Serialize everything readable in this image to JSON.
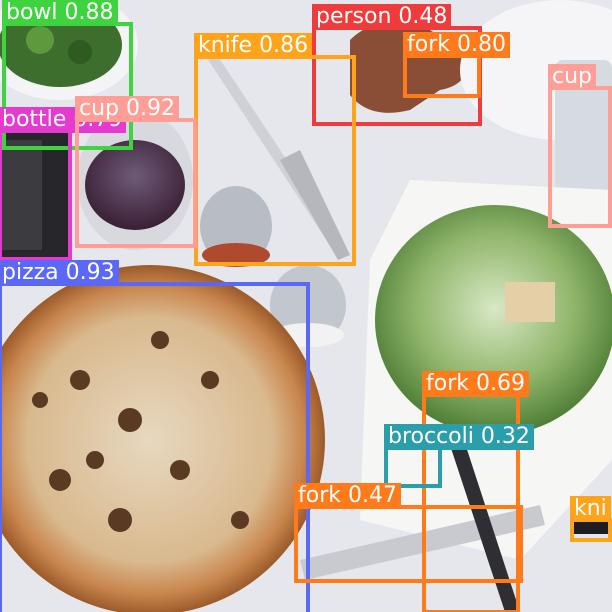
{
  "detections": [
    {
      "label": "bowl",
      "score": "0.88",
      "color": "#3fd43f"
    },
    {
      "label": "person",
      "score": "0.48",
      "color": "#ef3b3b"
    },
    {
      "label": "knife",
      "score": "0.86",
      "color": "#ffa31a"
    },
    {
      "label": "fork",
      "score": "0.80",
      "color": "#ff7a1a"
    },
    {
      "label": "cup",
      "score": "",
      "color": "#ff9e96"
    },
    {
      "label": "bottle",
      "score": "0.79",
      "color": "#e43ad0"
    },
    {
      "label": "cup",
      "score": "0.92",
      "color": "#ff9e96"
    },
    {
      "label": "pizza",
      "score": "0.93",
      "color": "#5a68f5"
    },
    {
      "label": "fork",
      "score": "0.69",
      "color": "#ff7a1a"
    },
    {
      "label": "broccoli",
      "score": "0.32",
      "color": "#2a9eaa"
    },
    {
      "label": "fork",
      "score": "0.47",
      "color": "#ff7a1a"
    },
    {
      "label": "kni",
      "score": "",
      "color": "#ffa31a"
    }
  ]
}
